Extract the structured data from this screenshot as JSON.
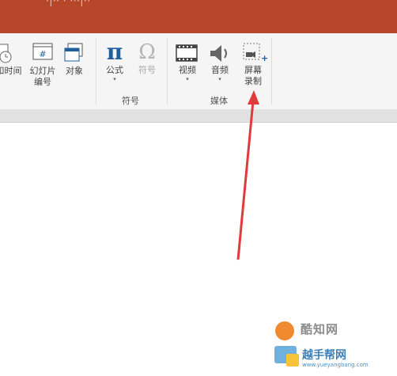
{
  "titlebar": {
    "text": "·|·· ·  ···|··",
    "color": "#b7472a"
  },
  "ribbon": {
    "insert_group": {
      "date_time_label": "日期和时间",
      "date_time_visible": "和时间",
      "slide_number_label_line1": "幻灯片",
      "slide_number_label_line2": "编号",
      "object_label": "对象"
    },
    "symbols_group": {
      "group_label": "符号",
      "equation_label": "公式",
      "symbol_label": "符号"
    },
    "media_group": {
      "group_label": "媒体",
      "video_label": "视频",
      "audio_label": "音频",
      "screen_recording_line1": "屏幕",
      "screen_recording_line2": "录制"
    }
  },
  "annotation": {
    "arrow_color": "#e03a3a"
  },
  "watermark": {
    "line1": "酷知网",
    "line2": "越手帮网",
    "url": "www.yueyangbang.com"
  }
}
